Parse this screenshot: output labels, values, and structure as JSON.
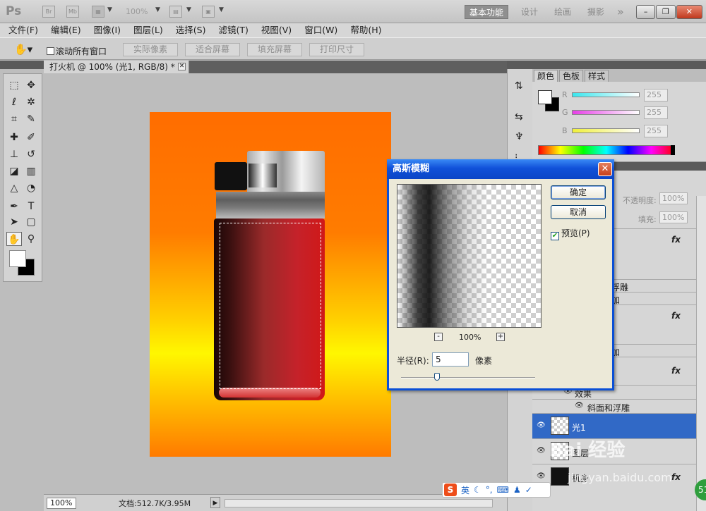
{
  "app": {
    "logo": "Ps",
    "bridge_label": "Br",
    "minibridge_label": "Mb",
    "zoom": "100%",
    "workspaces": [
      "基本功能",
      "设计",
      "绘画",
      "摄影"
    ],
    "workspace_more": "»"
  },
  "menu": [
    "文件(F)",
    "编辑(E)",
    "图像(I)",
    "图层(L)",
    "选择(S)",
    "滤镜(T)",
    "视图(V)",
    "窗口(W)",
    "帮助(H)"
  ],
  "options": {
    "scroll_all": "滚动所有窗口",
    "buttons": [
      "实际像素",
      "适合屏幕",
      "填充屏幕",
      "打印尺寸"
    ]
  },
  "document": {
    "tab_title": "打火机 @ 100% (光1, RGB/8) *",
    "status_zoom": "100%",
    "status_doc": "文档:512.7K/3.95M"
  },
  "color_panel": {
    "tabs": [
      "颜色",
      "色板",
      "样式"
    ],
    "channels": [
      {
        "label": "R",
        "value": "255",
        "color": "#39e6ee"
      },
      {
        "label": "G",
        "value": "255",
        "color": "#e63ee6"
      },
      {
        "label": "B",
        "value": "255",
        "color": "#f0f03a"
      }
    ]
  },
  "layers_panel": {
    "opacity_label": "不透明度:",
    "opacity_value": "100%",
    "fill_label": "填充:",
    "fill_value": "100%",
    "fx_label": "fx",
    "rows": {
      "bevel_partial": "浮雕",
      "add_partial_1": "加",
      "add_partial_2": "加",
      "effects": "效果",
      "bevel": "斜面和浮雕",
      "layer_light": "光1",
      "layer_shape": "图层",
      "layer_body": "机身"
    }
  },
  "dialog": {
    "title": "高斯模糊",
    "ok": "确定",
    "cancel": "取消",
    "preview_label": "预览(P)",
    "preview_checked": true,
    "zoom_out": "-",
    "zoom_in": "+",
    "zoom_level": "100%",
    "radius_label": "半径(R):",
    "radius_value": "5",
    "radius_unit": "像素",
    "radius_slider_fraction": 0.27
  },
  "ime": {
    "logo": "S",
    "mode": "英"
  },
  "watermark": {
    "brand": "Bai 经验",
    "url": "jingyan.baidu.com"
  },
  "badge": "51"
}
